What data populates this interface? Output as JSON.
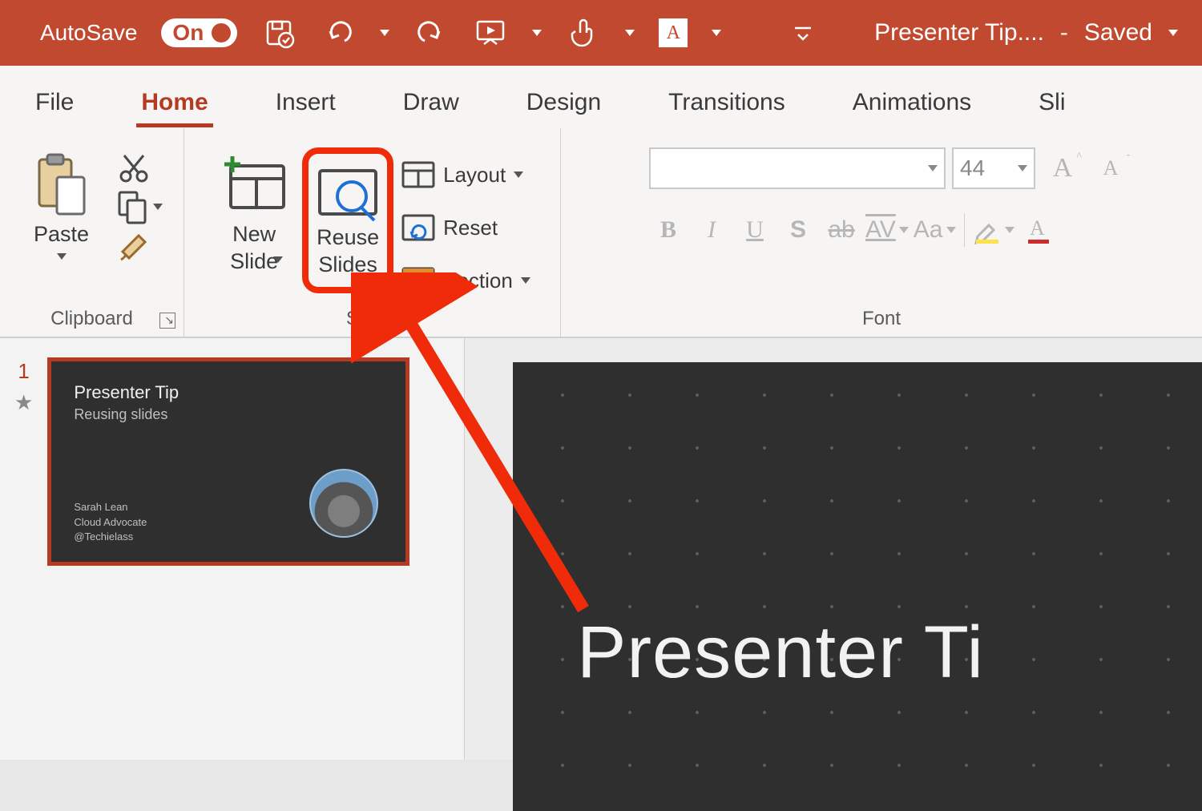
{
  "titlebar": {
    "autosave": "AutoSave",
    "autosave_state": "On",
    "doc_name": "Presenter Tip....",
    "save_state": "Saved"
  },
  "tabs": [
    "File",
    "Home",
    "Insert",
    "Draw",
    "Design",
    "Transitions",
    "Animations",
    "Sli"
  ],
  "active_tab": "Home",
  "clipboard": {
    "paste": "Paste",
    "group": "Clipboard"
  },
  "slides": {
    "new_slide": "New\nSlide",
    "reuse": "Reuse\nSlides",
    "layout": "Layout",
    "reset": "Reset",
    "section": "Section",
    "group": "Slides"
  },
  "font": {
    "size": "44",
    "group": "Font",
    "bold": "B",
    "italic": "I",
    "underline": "U",
    "shadow": "S",
    "strike": "ab",
    "spacing": "AV",
    "case": "Aa",
    "grow": "A",
    "shrink": "A"
  },
  "thumb": {
    "index": "1",
    "title": "Presenter Tip",
    "subtitle": "Reusing slides",
    "meta1": "Sarah Lean",
    "meta2": "Cloud Advocate",
    "meta3": "@Techielass"
  },
  "main_slide": {
    "headline": "Presenter Ti"
  }
}
